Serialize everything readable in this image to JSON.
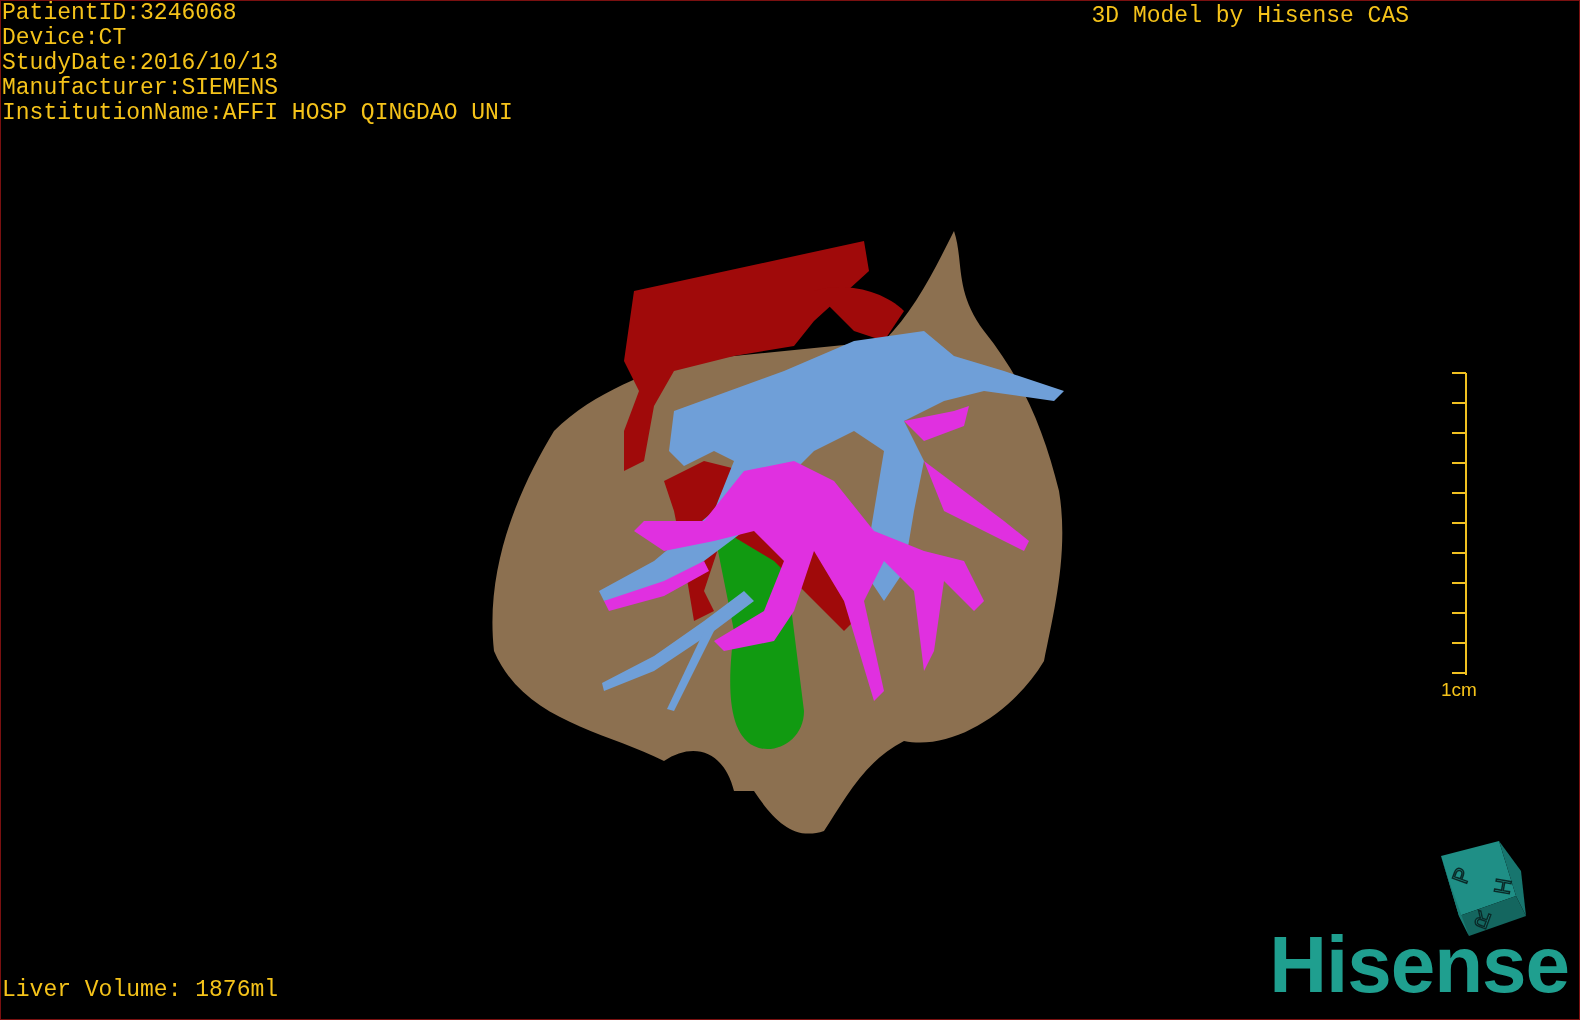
{
  "patient_info": [
    "PatientID:3246068",
    "Device:CT",
    "StudyDate:2016/10/13",
    "Manufacturer:SIEMENS",
    "InstitutionName:AFFI HOSP QINGDAO UNI"
  ],
  "title": "3D Model by Hisense CAS",
  "scale_bar": {
    "label": "1cm"
  },
  "orientation_cube": {
    "labels": [
      "P",
      "H",
      "R"
    ]
  },
  "logo": "Hisense",
  "footer": "Liver Volume: 1876ml"
}
